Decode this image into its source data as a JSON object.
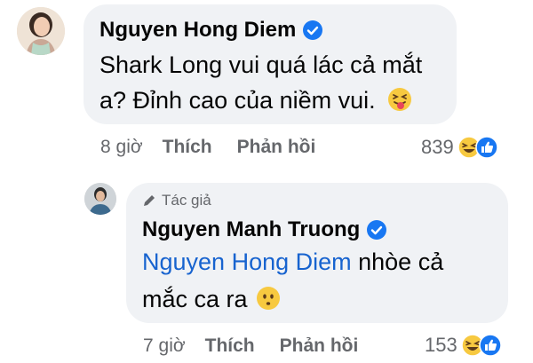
{
  "comments": [
    {
      "author": "Nguyen Hong Diem",
      "verified": true,
      "text_line1": "Shark Long vui quá lác cả mắt",
      "text_line2": "a? Đỉnh cao của niềm vui.",
      "emoji": "squinting-tongue-face",
      "time": "8 giờ",
      "like_label": "Thích",
      "reply_label": "Phản hồi",
      "reaction_count": "839",
      "reactions": [
        "haha",
        "like"
      ]
    },
    {
      "badge": "Tác giả",
      "author": "Nguyen Manh Truong",
      "verified": true,
      "mention": "Nguyen Hong Diem",
      "text_after_mention": " nhòe cả",
      "text_line2": "mắc ca ra",
      "emoji": "neutral-face",
      "time": "7 giờ",
      "like_label": "Thích",
      "reply_label": "Phản hồi",
      "reaction_count": "153",
      "reactions": [
        "haha",
        "like"
      ]
    }
  ],
  "colors": {
    "bubble": "#f0f2f5",
    "meta_text": "#65676b",
    "verified": "#1877f2",
    "mention": "#1763cf"
  }
}
